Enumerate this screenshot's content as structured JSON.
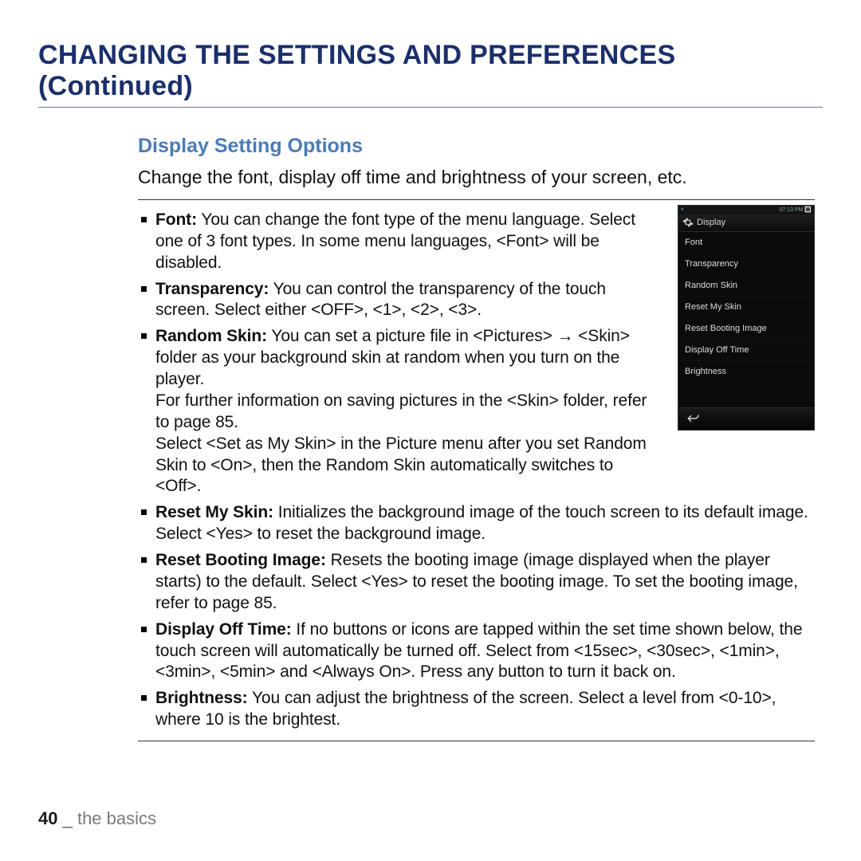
{
  "title": "CHANGING THE SETTINGS AND PREFERENCES (Continued)",
  "section_title": "Display Setting Options",
  "intro": "Change the font, display off time and brightness of your screen, etc.",
  "options": [
    {
      "label": "Font:",
      "text": " You can change the font type of the menu language. Select one of 3 font types. In some menu languages, <Font> will be disabled."
    },
    {
      "label": "Transparency:",
      "text": " You can control the transparency of the touch screen. Select either <OFF>, <1>, <2>, <3>."
    },
    {
      "label": "Random Skin:",
      "text": " You can set a picture file in <Pictures> → <Skin> folder as your background skin at random when you turn on the player.\nFor further information on saving pictures in the <Skin> folder, refer to page 85.\nSelect <Set as My Skin> in the Picture menu after you set Random Skin to <On>, then the Random Skin automatically switches to <Off>."
    },
    {
      "label": "Reset My Skin:",
      "text": " Initializes the background image of the touch screen to its default image. Select <Yes> to reset the background image."
    },
    {
      "label": "Reset Booting Image:",
      "text": " Resets the booting image (image displayed when the player starts) to the default. Select <Yes> to reset the booting image. To set the booting image, refer to page 85."
    },
    {
      "label": "Display Off Time:",
      "text": " If no buttons or icons are tapped within the set time shown below, the touch screen will automatically be turned off. Select from <15sec>, <30sec>, <1min>, <3min>, <5min> and <Always On>. Press any button to turn it back on."
    },
    {
      "label": "Brightness:",
      "text": " You can adjust the brightness of the screen. Select a level from <0-10>, where 10 is the brightest."
    }
  ],
  "device": {
    "status_time": "07:13 PM",
    "header": "Display",
    "items": [
      "Font",
      "Transparency",
      "Random Skin",
      "Reset My Skin",
      "Reset Booting Image",
      "Display Off Time",
      "Brightness"
    ]
  },
  "footer": {
    "page": "40",
    "sep": " _ ",
    "section": "the basics"
  }
}
